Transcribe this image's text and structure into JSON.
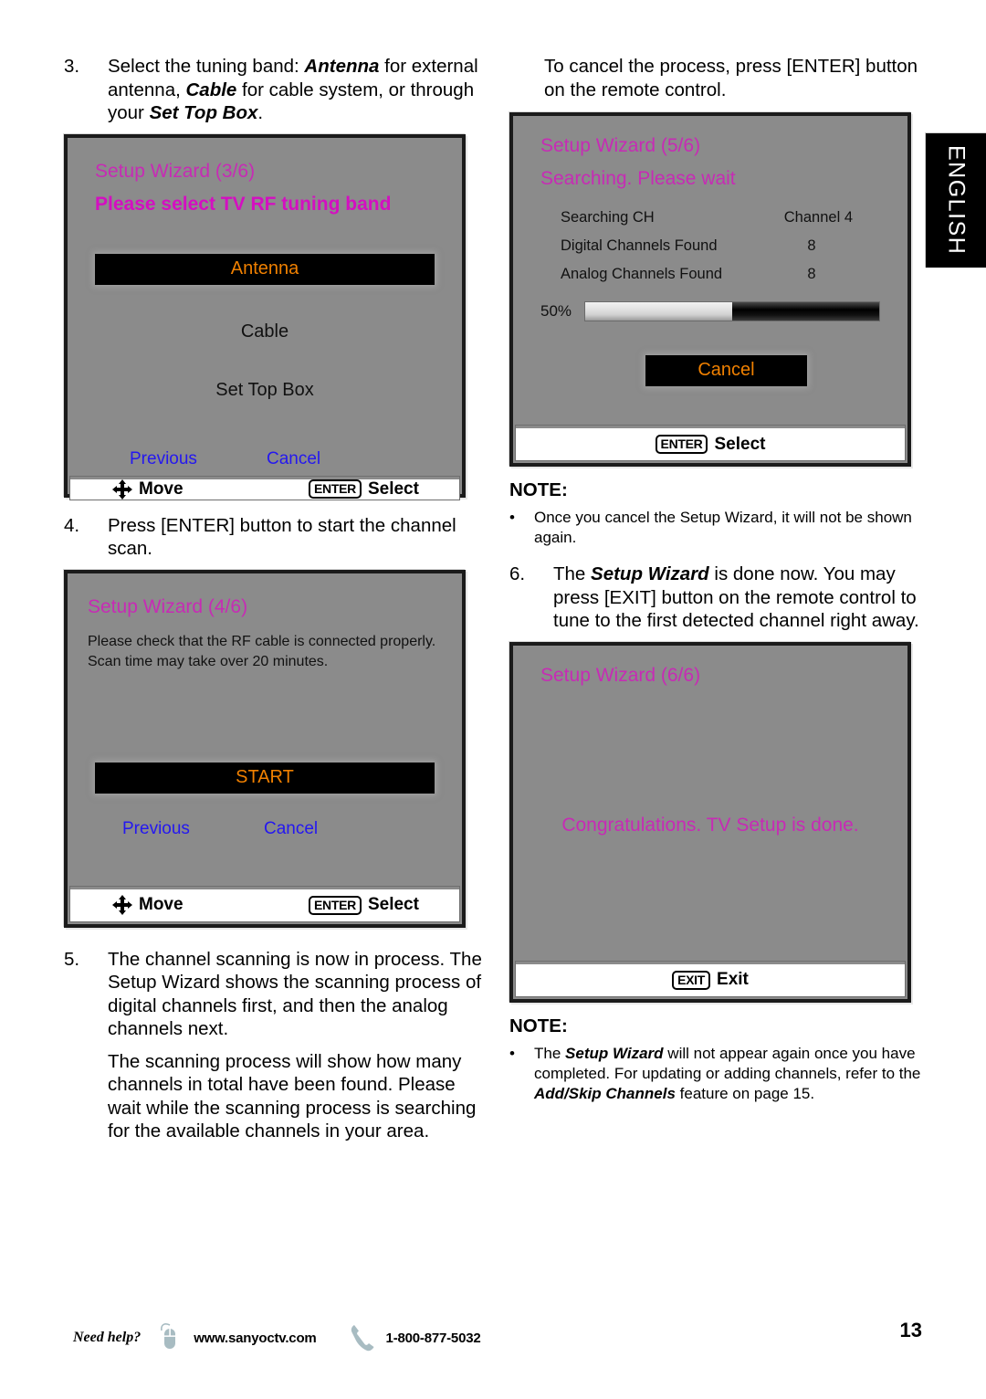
{
  "language_tab": {
    "label": "ENGLISH"
  },
  "left_column": {
    "step3": {
      "number": "3.",
      "text_parts": [
        {
          "t": "Select the tuning band: ",
          "bi": false
        },
        {
          "t": "Antenna",
          "bi": true
        },
        {
          "t": " for external antenna, ",
          "bi": false
        },
        {
          "t": "Cable",
          "bi": true
        },
        {
          "t": " for cable system, or through your ",
          "bi": false
        },
        {
          "t": "Set Top Box",
          "bi": true
        },
        {
          "t": ".",
          "bi": false
        }
      ]
    },
    "screen_3_6": {
      "title": "Setup Wizard (3/6)",
      "subtitle": "Please select TV RF tuning band",
      "options": [
        "Antenna",
        "Cable",
        "Set Top Box"
      ],
      "selected_option": "Antenna",
      "links": [
        "Previous",
        "Cancel"
      ],
      "bar": {
        "move_key": "",
        "move_label": "Move",
        "enter_key": "ENTER",
        "enter_label": "Select"
      }
    },
    "step4": {
      "number": "4.",
      "text": "Press [ENTER] button to start the channel scan."
    },
    "screen_4_6": {
      "title": "Setup Wizard (4/6)",
      "info_line1": "Please check that the RF cable is connected properly.",
      "info_line2": "Scan time may take over 20 minutes.",
      "start_button": "START",
      "links": [
        "Previous",
        "Cancel"
      ],
      "bar": {
        "move_label": "Move",
        "enter_key": "ENTER",
        "enter_label": "Select"
      }
    },
    "step5": {
      "number": "5.",
      "text": "The channel scanning is now in process. The Setup Wizard shows the scanning process of digital channels first, and then the analog channels next.",
      "text2": "The scanning process will show how many channels in total have been found. Please wait while the scanning process is searching for the available channels in your area."
    }
  },
  "right_column": {
    "intro": "To cancel the process, press [ENTER] button on the remote control.",
    "screen_5_6": {
      "title": "Setup Wizard (5/6)",
      "subtitle": "Searching. Please wait",
      "rows": [
        {
          "label": "Searching CH",
          "value": "Channel 4"
        },
        {
          "label": "Digital Channels Found",
          "value": "8"
        },
        {
          "label": "Analog Channels Found",
          "value": "8"
        }
      ],
      "progress_label": "50%",
      "progress_percent": 50,
      "cancel_button": "Cancel",
      "bar": {
        "enter_key": "ENTER",
        "enter_label": "Select"
      }
    },
    "note1": {
      "head": "NOTE:",
      "bullet": "•",
      "text": "Once you cancel the Setup Wizard, it will not be shown again."
    },
    "step6": {
      "number": "6.",
      "text_parts": [
        {
          "t": "The ",
          "bi": false
        },
        {
          "t": "Setup Wizard",
          "bi": true
        },
        {
          "t": " is done now. You may press [EXIT] button on the remote control to tune to the first detected channel right away.",
          "bi": false
        }
      ]
    },
    "screen_6_6": {
      "title": "Setup Wizard (6/6)",
      "message": "Congratulations. TV Setup is done.",
      "bar": {
        "exit_key": "EXIT",
        "exit_label": "Exit"
      }
    },
    "note2": {
      "head": "NOTE:",
      "bullet": "•",
      "text_parts": [
        {
          "t": "The ",
          "bi": false
        },
        {
          "t": "Setup Wizard",
          "bi": true
        },
        {
          "t": " will not appear again once you have completed. For updating or adding channels, refer to the ",
          "bi": false
        },
        {
          "t": "Add/Skip Channels",
          "bi": true
        },
        {
          "t": " feature on page 15.",
          "bi": false
        }
      ]
    }
  },
  "footer": {
    "need_help": "Need help?",
    "website": "www.sanyoctv.com",
    "phone": "1-800-877-5032",
    "page_number": "13"
  },
  "colors": {
    "osd_magenta": "#c72bb5",
    "osd_orange": "#f08000",
    "osd_blue": "#2417f0",
    "osd_gray": "#8b8b8b"
  }
}
